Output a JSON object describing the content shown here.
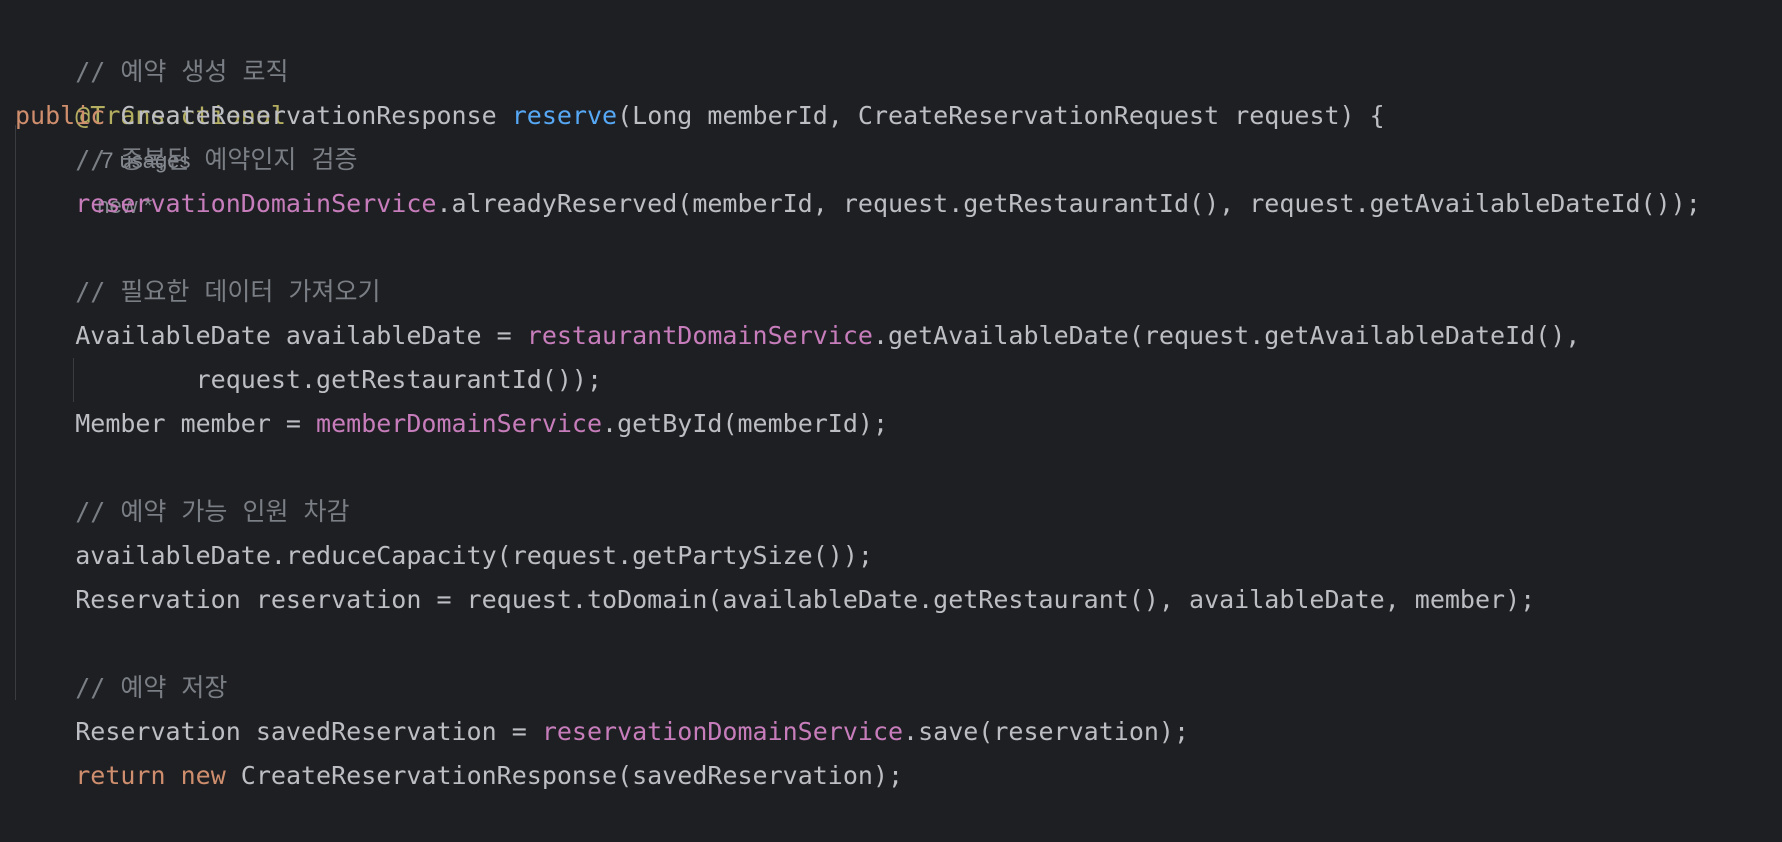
{
  "colors": {
    "background": "#1e1f22",
    "text": "#bcbec4",
    "comment": "#7a7e85",
    "annotation": "#b3ae60",
    "keyword": "#cf8e6d",
    "method_decl": "#56a8f5",
    "field": "#c77dbb",
    "inlay_hint": "#868a91"
  },
  "code": {
    "c_create": "// 예약 생성 로직",
    "annotation": "@Transactional",
    "usages": "7 usages",
    "author": "new *",
    "kw_public": "public",
    "ret_type": "CreateReservationResponse",
    "method_name": "reserve",
    "params": "(Long memberId, CreateReservationRequest request) {",
    "c_dup": "// 중복된 예약인지 검증",
    "f_reservation_service": "reservationDomainService",
    "l_already": ".alreadyReserved(memberId, request.getRestaurantId(), request.getAvailableDateId());",
    "c_fetch": "// 필요한 데이터 가져오기",
    "l_avail_decl": "AvailableDate availableDate = ",
    "f_restaurant_service": "restaurantDomainService",
    "l_avail_call": ".getAvailableDate(request.getAvailableDateId(),",
    "l_avail_cont": "request.getRestaurantId());",
    "l_member_decl": "Member member = ",
    "f_member_service": "memberDomainService",
    "l_member_call": ".getById(memberId);",
    "c_capacity": "// 예약 가능 인원 차감",
    "l_reduce": "availableDate.reduceCapacity(request.getPartySize());",
    "l_reservation": "Reservation reservation = request.toDomain(availableDate.getRestaurant(), availableDate, member);",
    "c_save": "// 예약 저장",
    "l_saved_decl": "Reservation savedReservation = ",
    "f_reservation_service2": "reservationDomainService",
    "l_save_call": ".save(reservation);",
    "kw_return": "return",
    "kw_new": "new",
    "l_return_rest": " CreateReservationResponse(savedReservation);",
    "close_brace": "}"
  }
}
